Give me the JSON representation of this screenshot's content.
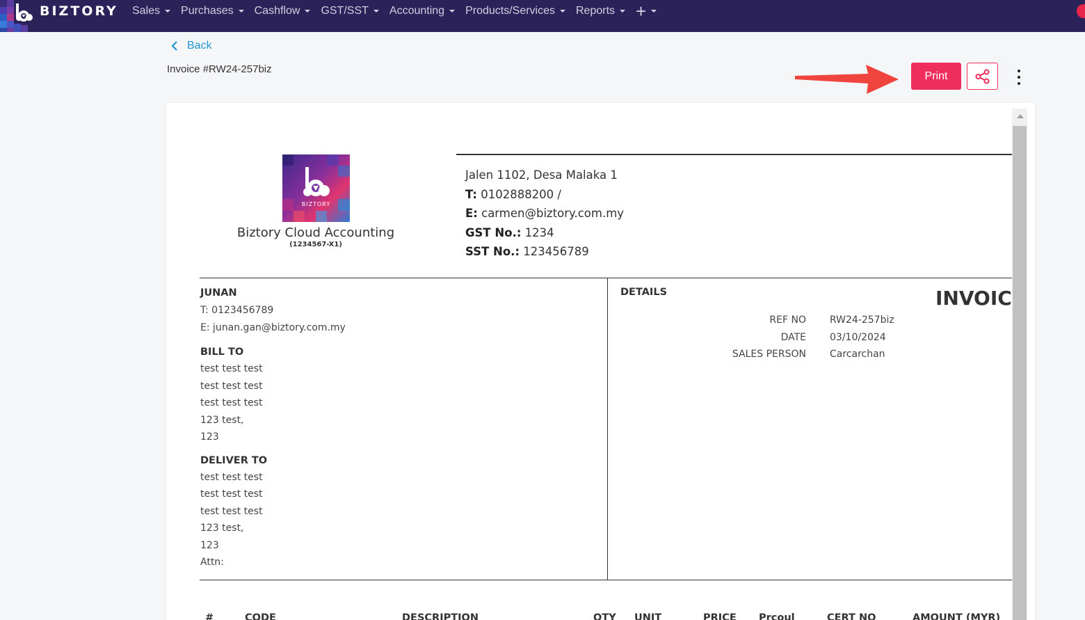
{
  "app": {
    "brand": "BIZTORY",
    "menu": [
      {
        "label": "Sales"
      },
      {
        "label": "Purchases"
      },
      {
        "label": "Cashflow"
      },
      {
        "label": "GST/SST"
      },
      {
        "label": "Accounting"
      },
      {
        "label": "Products/Services"
      },
      {
        "label": "Reports"
      }
    ],
    "plus_label": "+"
  },
  "header": {
    "back_label": "Back",
    "invoice_title": "Invoice #RW24-257biz",
    "print_label": "Print"
  },
  "colors": {
    "nav_bg": "#2b2259",
    "accent": "#ee2f5d",
    "link": "#2196d3"
  },
  "company": {
    "logo_text": "BIZTORY",
    "name": "Biztory Cloud Accounting",
    "reg": "(1234567-X1)",
    "address": "Jalen 1102, Desa Malaka 1",
    "phone_label": "T:",
    "phone": "0102888200 /",
    "email_label": "E:",
    "email": "carmen@biztory.com.my",
    "gst_label": "GST No.:",
    "gst": "1234",
    "sst_label": "SST No.:",
    "sst": "123456789"
  },
  "customer": {
    "name": "JUNAN",
    "phone": "T: 0123456789",
    "email": "E: junan.gan@biztory.com.my",
    "bill_to_heading": "BILL TO",
    "bill_to": [
      "test test test",
      "test test test",
      "test test test",
      "123 test,",
      "123"
    ],
    "deliver_to_heading": "DELIVER TO",
    "deliver_to": [
      "test test test",
      "test test test",
      "test test test",
      "123 test,",
      "123"
    ],
    "attn": "Attn:"
  },
  "details": {
    "heading": "DETAILS",
    "doc_type": "INVOICE",
    "ref_label": "REF NO",
    "ref_value": "RW24-257biz",
    "date_label": "DATE",
    "date_value": "03/10/2024",
    "sales_label": "SALES PERSON",
    "sales_value": "Carcarchan"
  },
  "table_headers": {
    "num": "#",
    "code": "CODE",
    "description": "DESCRIPTION",
    "qty": "QTY",
    "unit": "UNIT",
    "price": "PRICE",
    "discount": "Prcoul",
    "cert": "CERT NO",
    "amount": "AMOUNT (MYR)"
  }
}
